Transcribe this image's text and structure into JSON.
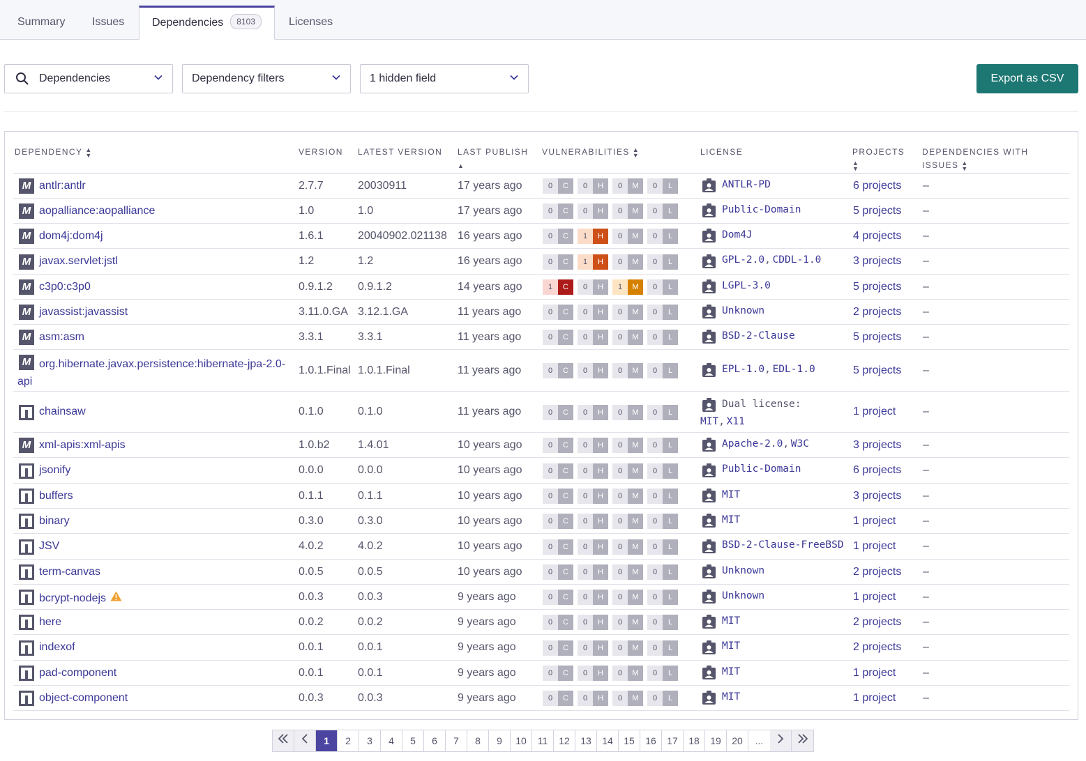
{
  "tabs": [
    {
      "label": "Summary"
    },
    {
      "label": "Issues"
    },
    {
      "label": "Dependencies",
      "count": "8103"
    },
    {
      "label": "Licenses"
    }
  ],
  "filters": {
    "search_label": "Dependencies",
    "dep_filters_label": "Dependency filters",
    "hidden_fields_label": "1 hidden field",
    "export_label": "Export as CSV"
  },
  "columns": {
    "dependency": "Dependency",
    "version": "Version",
    "latest_version": "Latest version",
    "last_publish": "Last publish",
    "vulnerabilities": "Vulnerabilities",
    "license": "License",
    "projects": "Projects",
    "dependencies_with_issues": "Dependencies with issues"
  },
  "vuln_letters": [
    "C",
    "H",
    "M",
    "L"
  ],
  "rows": [
    {
      "type": "maven",
      "name": "antlr:antlr",
      "version": "2.7.7",
      "latest": "20030911",
      "publish": "17 years ago",
      "vuln": [
        0,
        0,
        0,
        0
      ],
      "license": [
        "ANTLR-PD"
      ],
      "projects": "6 projects",
      "issues": "–"
    },
    {
      "type": "maven",
      "name": "aopalliance:aopalliance",
      "version": "1.0",
      "latest": "1.0",
      "publish": "17 years ago",
      "vuln": [
        0,
        0,
        0,
        0
      ],
      "license": [
        "Public-Domain"
      ],
      "projects": "5 projects",
      "issues": "–"
    },
    {
      "type": "maven",
      "name": "dom4j:dom4j",
      "version": "1.6.1",
      "latest": "20040902.021138",
      "publish": "16 years ago",
      "vuln": [
        0,
        1,
        0,
        0
      ],
      "license": [
        "Dom4J"
      ],
      "projects": "4 projects",
      "issues": "–"
    },
    {
      "type": "maven",
      "name": "javax.servlet:jstl",
      "version": "1.2",
      "latest": "1.2",
      "publish": "16 years ago",
      "vuln": [
        0,
        1,
        0,
        0
      ],
      "license": [
        "GPL-2.0",
        "CDDL-1.0"
      ],
      "projects": "3 projects",
      "issues": "–"
    },
    {
      "type": "maven",
      "name": "c3p0:c3p0",
      "version": "0.9.1.2",
      "latest": "0.9.1.2",
      "publish": "14 years ago",
      "vuln": [
        1,
        0,
        1,
        0
      ],
      "license": [
        "LGPL-3.0"
      ],
      "projects": "5 projects",
      "issues": "–"
    },
    {
      "type": "maven",
      "name": "javassist:javassist",
      "version": "3.11.0.GA",
      "latest": "3.12.1.GA",
      "publish": "11 years ago",
      "vuln": [
        0,
        0,
        0,
        0
      ],
      "license": [
        "Unknown"
      ],
      "projects": "2 projects",
      "issues": "–"
    },
    {
      "type": "maven",
      "name": "asm:asm",
      "version": "3.3.1",
      "latest": "3.3.1",
      "publish": "11 years ago",
      "vuln": [
        0,
        0,
        0,
        0
      ],
      "license": [
        "BSD-2-Clause"
      ],
      "projects": "5 projects",
      "issues": "–"
    },
    {
      "type": "maven",
      "name": "org.hibernate.javax.persistence:hibernate-jpa-2.0-",
      "name2": "api",
      "version": "1.0.1.Final",
      "latest": "1.0.1.Final",
      "publish": "11 years ago",
      "vuln": [
        0,
        0,
        0,
        0
      ],
      "license": [
        "EPL-1.0",
        "EDL-1.0"
      ],
      "projects": "5 projects",
      "issues": "–"
    },
    {
      "type": "npm",
      "name": "chainsaw",
      "version": "0.1.0",
      "latest": "0.1.0",
      "publish": "11 years ago",
      "vuln": [
        0,
        0,
        0,
        0
      ],
      "license_prefix": "Dual license:",
      "license": [
        "MIT",
        "X11"
      ],
      "projects": "1 project",
      "issues": "–"
    },
    {
      "type": "maven",
      "name": "xml-apis:xml-apis",
      "version": "1.0.b2",
      "latest": "1.4.01",
      "publish": "10 years ago",
      "vuln": [
        0,
        0,
        0,
        0
      ],
      "license": [
        "Apache-2.0",
        "W3C"
      ],
      "projects": "3 projects",
      "issues": "–"
    },
    {
      "type": "npm",
      "name": "jsonify",
      "version": "0.0.0",
      "latest": "0.0.0",
      "publish": "10 years ago",
      "vuln": [
        0,
        0,
        0,
        0
      ],
      "license": [
        "Public-Domain"
      ],
      "projects": "6 projects",
      "issues": "–"
    },
    {
      "type": "npm",
      "name": "buffers",
      "version": "0.1.1",
      "latest": "0.1.1",
      "publish": "10 years ago",
      "vuln": [
        0,
        0,
        0,
        0
      ],
      "license": [
        "MIT"
      ],
      "projects": "3 projects",
      "issues": "–"
    },
    {
      "type": "npm",
      "name": "binary",
      "version": "0.3.0",
      "latest": "0.3.0",
      "publish": "10 years ago",
      "vuln": [
        0,
        0,
        0,
        0
      ],
      "license": [
        "MIT"
      ],
      "projects": "1 project",
      "issues": "–"
    },
    {
      "type": "npm",
      "name": "JSV",
      "version": "4.0.2",
      "latest": "4.0.2",
      "publish": "10 years ago",
      "vuln": [
        0,
        0,
        0,
        0
      ],
      "license": [
        "BSD-2-Clause-FreeBSD"
      ],
      "projects": "1 project",
      "issues": "–"
    },
    {
      "type": "npm",
      "name": "term-canvas",
      "version": "0.0.5",
      "latest": "0.0.5",
      "publish": "10 years ago",
      "vuln": [
        0,
        0,
        0,
        0
      ],
      "license": [
        "Unknown"
      ],
      "projects": "2 projects",
      "issues": "–"
    },
    {
      "type": "npm",
      "name": "bcrypt-nodejs",
      "warning": true,
      "version": "0.0.3",
      "latest": "0.0.3",
      "publish": "9 years ago",
      "vuln": [
        0,
        0,
        0,
        0
      ],
      "license": [
        "Unknown"
      ],
      "projects": "1 project",
      "issues": "–"
    },
    {
      "type": "npm",
      "name": "here",
      "version": "0.0.2",
      "latest": "0.0.2",
      "publish": "9 years ago",
      "vuln": [
        0,
        0,
        0,
        0
      ],
      "license": [
        "MIT"
      ],
      "projects": "2 projects",
      "issues": "–"
    },
    {
      "type": "npm",
      "name": "indexof",
      "version": "0.0.1",
      "latest": "0.0.1",
      "publish": "9 years ago",
      "vuln": [
        0,
        0,
        0,
        0
      ],
      "license": [
        "MIT"
      ],
      "projects": "2 projects",
      "issues": "–"
    },
    {
      "type": "npm",
      "name": "pad-component",
      "version": "0.0.1",
      "latest": "0.0.1",
      "publish": "9 years ago",
      "vuln": [
        0,
        0,
        0,
        0
      ],
      "license": [
        "MIT"
      ],
      "projects": "1 project",
      "issues": "–"
    },
    {
      "type": "npm",
      "name": "object-component",
      "version": "0.0.3",
      "latest": "0.0.3",
      "publish": "9 years ago",
      "vuln": [
        0,
        0,
        0,
        0
      ],
      "license": [
        "MIT"
      ],
      "projects": "1 project",
      "issues": "–"
    }
  ],
  "pagination": {
    "pages": [
      "1",
      "2",
      "3",
      "4",
      "5",
      "6",
      "7",
      "8",
      "9",
      "10",
      "11",
      "12",
      "13",
      "14",
      "15",
      "16",
      "17",
      "18",
      "19",
      "20",
      "..."
    ],
    "current": "1"
  },
  "colors": {
    "accent": "#4b45a1",
    "export_button": "#1d7773",
    "critical": "#ad1a1a",
    "high": "#ce5019",
    "medium": "#d68000",
    "link": "#3b3897"
  }
}
